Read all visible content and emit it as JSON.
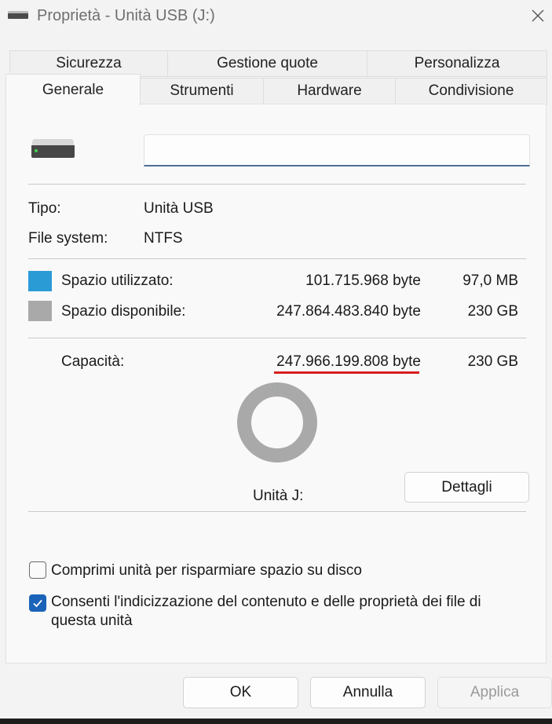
{
  "window": {
    "title": "Proprietà - Unità USB (J:)",
    "icon": "usb-drive-icon",
    "close_icon": "close-icon"
  },
  "tabs": {
    "row1": [
      "Sicurezza",
      "Gestione quote",
      "Personalizza"
    ],
    "row2": [
      "Generale",
      "Strumenti",
      "Hardware",
      "Condivisione"
    ],
    "active": "Generale"
  },
  "general": {
    "drive_icon": "usb-drive-icon",
    "name_value": "",
    "type_label": "Tipo:",
    "type_value": "Unità USB",
    "fs_label": "File system:",
    "fs_value": "NTFS",
    "used": {
      "label": "Spazio utilizzato:",
      "bytes": "101.715.968 byte",
      "size": "97,0 MB",
      "color": "#2b9bd6"
    },
    "free": {
      "label": "Spazio disponibile:",
      "bytes": "247.864.483.840 byte",
      "size": "230 GB",
      "color": "#a9a9a9"
    },
    "capacity": {
      "label": "Capacità:",
      "bytes": "247.966.199.808 byte",
      "size": "230 GB",
      "highlight_color": "#d81e1e"
    },
    "used_fraction": 0.0004,
    "drive_label": "Unità J:",
    "details_button": "Dettagli",
    "compress_label": "Comprimi unità per risparmiare spazio su disco",
    "compress_checked": false,
    "index_label_line1": "Consenti l'indicizzazione del contenuto e delle proprietà dei file di",
    "index_label_line2": "questa unità",
    "index_checked": true
  },
  "footer": {
    "ok": "OK",
    "cancel": "Annulla",
    "apply": "Applica",
    "apply_enabled": false
  }
}
